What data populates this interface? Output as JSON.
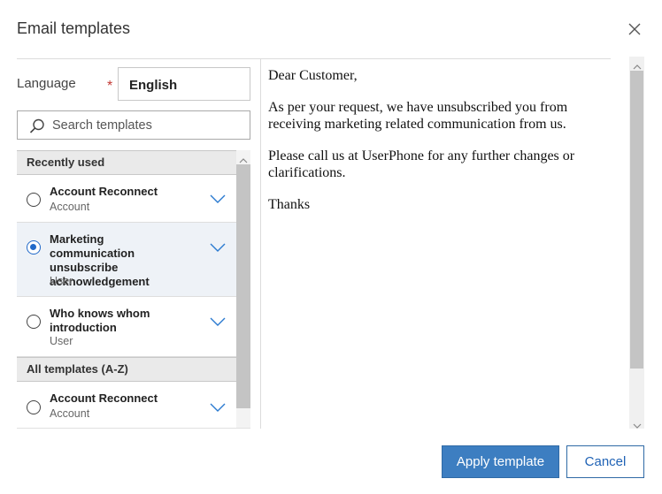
{
  "dialog": {
    "title": "Email templates",
    "close_icon": "close-icon"
  },
  "language": {
    "label": "Language",
    "required_mark": "*",
    "value": "English"
  },
  "search": {
    "placeholder": "Search templates",
    "value": ""
  },
  "sections": {
    "recent": {
      "label": "Recently used",
      "items": [
        {
          "name": "Account Reconnect",
          "sub": "Account",
          "selected": false
        },
        {
          "name": "Marketing communication unsubscribe acknowledgement",
          "sub": "User",
          "selected": true
        },
        {
          "name": "Who knows whom introduction",
          "sub": "User",
          "selected": false
        }
      ]
    },
    "all": {
      "label": "All templates (A-Z)",
      "items": [
        {
          "name": "Account Reconnect",
          "sub": "Account",
          "selected": false
        }
      ]
    }
  },
  "preview": {
    "paragraphs": [
      "Dear Customer,",
      "As per your request, we have unsubscribed you from receiving marketing related communication from us.",
      "Please call us at UserPhone for any further changes or clarifications.",
      "Thanks"
    ]
  },
  "buttons": {
    "apply": "Apply template",
    "cancel": "Cancel"
  },
  "colors": {
    "accent": "#3d7ec1",
    "radio_selected": "#2169c9",
    "required": "#c23934",
    "section_bg": "#eaeaea"
  }
}
